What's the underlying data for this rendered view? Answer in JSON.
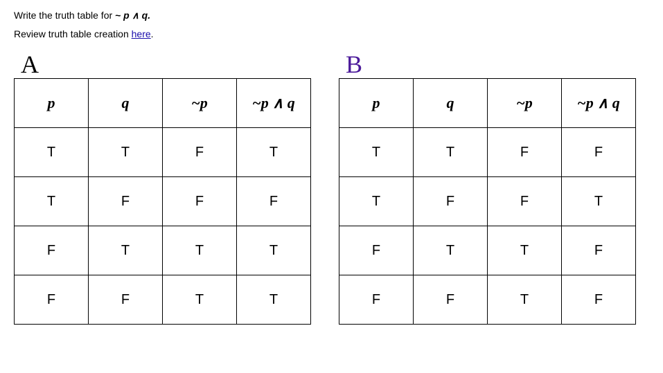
{
  "instruction_prefix": "Write the truth table for  ",
  "instruction_expr": "~ p ∧ q.",
  "review_prefix": "Review truth table creation ",
  "review_link_text": "here",
  "review_suffix": ".",
  "label_a": "A",
  "label_b": "B",
  "headers": {
    "p": "p",
    "q": "q",
    "notp": "~p",
    "notp_and_q": "~p ∧ q"
  },
  "table_a": {
    "rows": [
      {
        "p": "T",
        "q": "T",
        "notp": "F",
        "res": "T"
      },
      {
        "p": "T",
        "q": "F",
        "notp": "F",
        "res": "F"
      },
      {
        "p": "F",
        "q": "T",
        "notp": "T",
        "res": "T"
      },
      {
        "p": "F",
        "q": "F",
        "notp": "T",
        "res": "T"
      }
    ]
  },
  "table_b": {
    "rows": [
      {
        "p": "T",
        "q": "T",
        "notp": "F",
        "res": "F"
      },
      {
        "p": "T",
        "q": "F",
        "notp": "F",
        "res": "T"
      },
      {
        "p": "F",
        "q": "T",
        "notp": "T",
        "res": "F"
      },
      {
        "p": "F",
        "q": "F",
        "notp": "T",
        "res": "F"
      }
    ]
  }
}
